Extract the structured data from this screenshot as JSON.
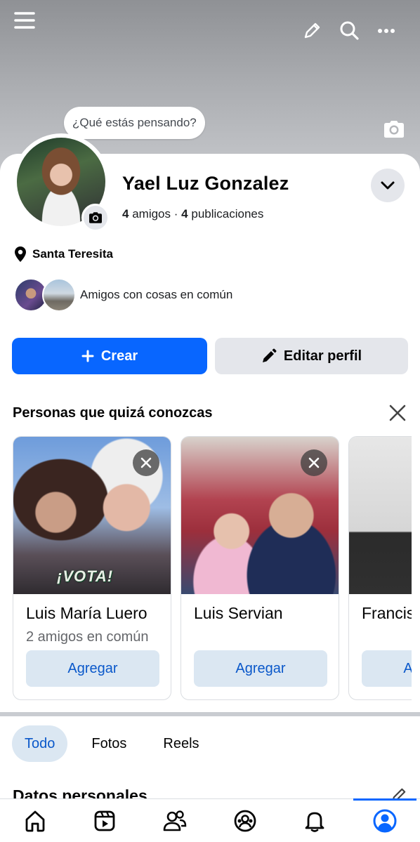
{
  "composer": {
    "prompt": "¿Qué estás pensando?"
  },
  "profile": {
    "name": "Yael Luz Gonzalez",
    "friends_count": "4",
    "friends_label": "amigos",
    "posts_count": "4",
    "posts_label": "publicaciones",
    "separator": "·",
    "location": "Santa Teresita",
    "mutual_text": "Amigos con cosas en común"
  },
  "actions": {
    "create_label": "Crear",
    "edit_label": "Editar perfil"
  },
  "pymk": {
    "title": "Personas que quizá conozcas",
    "people": [
      {
        "name": "Luis María Luero",
        "mutual": "2 amigos en común",
        "add_label": "Agregar",
        "photo_text": "¡VOTA!"
      },
      {
        "name": "Luis Servian",
        "mutual": "",
        "add_label": "Agregar"
      },
      {
        "name": "Francis",
        "mutual": "",
        "add_label": "Agregar"
      }
    ]
  },
  "tabs": [
    {
      "label": "Todo",
      "active": true
    },
    {
      "label": "Fotos",
      "active": false
    },
    {
      "label": "Reels",
      "active": false
    }
  ],
  "section": {
    "title": "Datos personales"
  },
  "nav": {
    "items": [
      "home-icon",
      "video-icon",
      "friends-icon",
      "marketplace-icon",
      "notifications-icon",
      "profile-icon"
    ],
    "active": "profile-icon"
  },
  "colors": {
    "primary": "#0866ff",
    "secondary_button": "#e4e6eb",
    "soft_blue": "#dbe7f2",
    "link_blue": "#0a58ca"
  }
}
